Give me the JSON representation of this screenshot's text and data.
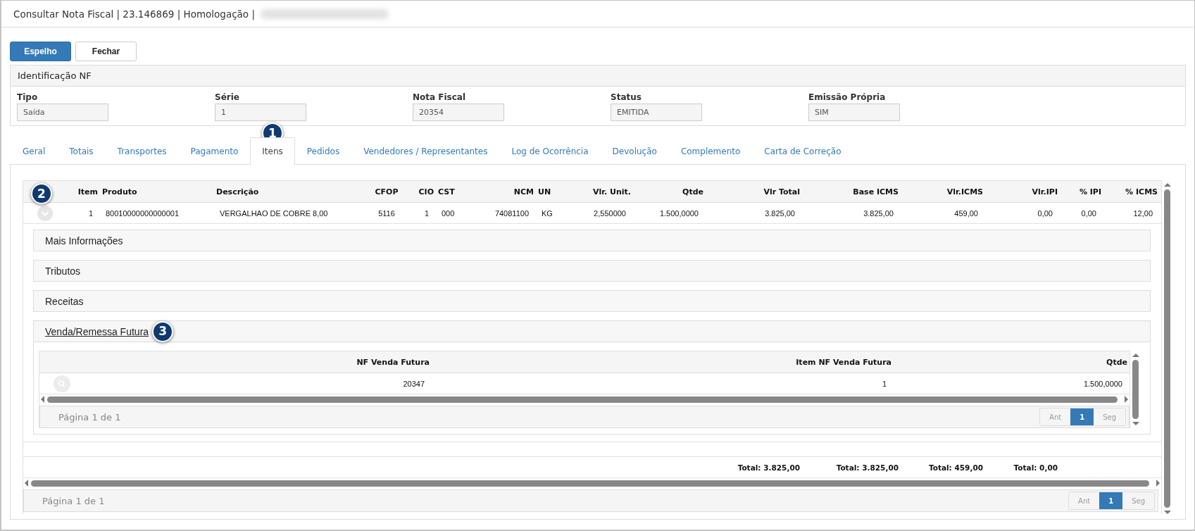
{
  "window": {
    "title": "Consultar Nota Fiscal | 23.146869 | Homologação |"
  },
  "buttons": [
    {
      "label": "Espelho",
      "kind": "primary"
    },
    {
      "label": "Fechar",
      "kind": "default"
    }
  ],
  "identification": {
    "title": "Identificação NF",
    "fields": [
      {
        "label": "Tipo",
        "value": "Saída"
      },
      {
        "label": "Série",
        "value": "1"
      },
      {
        "label": "Nota Fiscal",
        "value": "20354"
      },
      {
        "label": "Status",
        "value": "EMITIDA"
      },
      {
        "label": "Emissão Própria",
        "value": "SIM"
      }
    ]
  },
  "tabs": [
    {
      "label": "Geral",
      "selected": false
    },
    {
      "label": "Totais",
      "selected": false
    },
    {
      "label": "Transportes",
      "selected": false
    },
    {
      "label": "Pagamento",
      "selected": false
    },
    {
      "label": "Itens",
      "selected": true,
      "badge": "1"
    },
    {
      "label": "Pedidos",
      "selected": false
    },
    {
      "label": "Vendedores / Representantes",
      "selected": false
    },
    {
      "label": "Log de Ocorrência",
      "selected": false
    },
    {
      "label": "Devolução",
      "selected": false
    },
    {
      "label": "Complemento",
      "selected": false
    },
    {
      "label": "Carta de Correção",
      "selected": false
    }
  ],
  "items_table": {
    "badge": "2",
    "columns": [
      {
        "label": "Item"
      },
      {
        "label": "Produto"
      },
      {
        "label": "Descrição"
      },
      {
        "label": "CFOP"
      },
      {
        "label": "CIO"
      },
      {
        "label": "CST"
      },
      {
        "label": "NCM"
      },
      {
        "label": "UN"
      },
      {
        "label": "Vlr. Unit."
      },
      {
        "label": "Qtde"
      },
      {
        "label": "Vlr Total",
        "total": "Total: 3.825,00"
      },
      {
        "label": "Base ICMS",
        "total": "Total: 3.825,00"
      },
      {
        "label": "Vlr.ICMS",
        "total": "Total: 459,00"
      },
      {
        "label": "Vlr.IPI",
        "total": "Total: 0,00"
      },
      {
        "label": "% IPI"
      },
      {
        "label": "% ICMS"
      }
    ],
    "rows": [
      {
        "expanded": true,
        "cells": [
          "1",
          "80010000000000001",
          "VERGALHAO DE COBRE 8,00",
          "5116",
          "1",
          "000",
          "74081100",
          "KG",
          "2,550000",
          "1.500,0000",
          "3.825,00",
          "3.825,00",
          "459,00",
          "0,00",
          "0,00",
          "12,00"
        ],
        "sections": [
          {
            "title": "Mais Informações",
            "expanded": false
          },
          {
            "title": "Tributos",
            "expanded": false
          },
          {
            "title": "Receitas",
            "expanded": false
          },
          {
            "title": "Venda/Remessa Futura",
            "expanded": true,
            "badge": "3",
            "table": {
              "columns": [
                {
                  "label": "NF Venda Futura"
                },
                {
                  "label": "Item NF Venda Futura"
                },
                {
                  "label": "Qtde"
                }
              ],
              "rows": [
                {
                  "cells": [
                    "20347",
                    "1",
                    "1.500,0000"
                  ]
                }
              ],
              "pager": {
                "text": "Página 1 de 1",
                "buttons": [
                  {
                    "label": "Ant",
                    "selected": false
                  },
                  {
                    "label": "1",
                    "selected": true
                  },
                  {
                    "label": "Seg",
                    "selected": false
                  }
                ]
              }
            }
          }
        ]
      }
    ],
    "pager": {
      "text": "Página 1 de 1",
      "buttons": [
        {
          "label": "Ant",
          "selected": false
        },
        {
          "label": "1",
          "selected": true
        },
        {
          "label": "Seg",
          "selected": false
        }
      ]
    }
  }
}
